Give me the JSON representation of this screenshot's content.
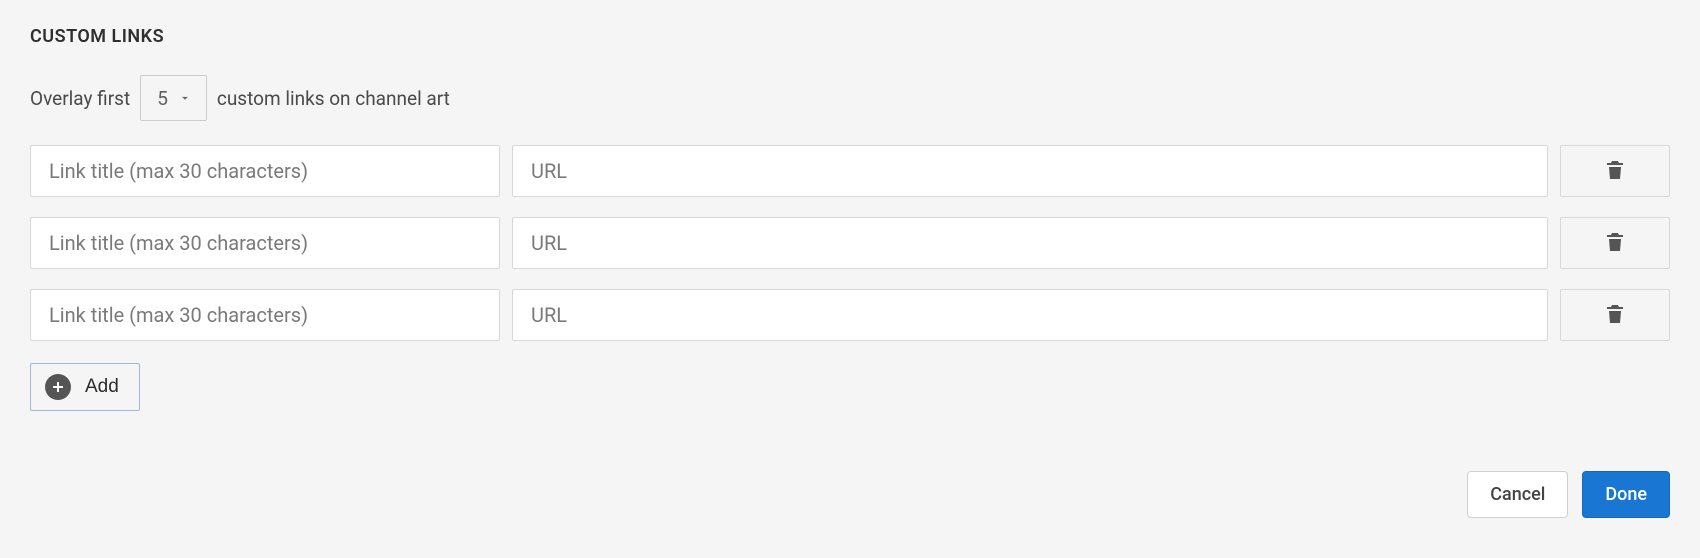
{
  "section_title": "CUSTOM LINKS",
  "overlay": {
    "prefix": "Overlay first",
    "value": "5",
    "suffix": "custom links on channel art"
  },
  "rows": [
    {
      "title_placeholder": "Link title (max 30 characters)",
      "url_placeholder": "URL"
    },
    {
      "title_placeholder": "Link title (max 30 characters)",
      "url_placeholder": "URL"
    },
    {
      "title_placeholder": "Link title (max 30 characters)",
      "url_placeholder": "URL"
    }
  ],
  "add_label": "Add",
  "footer": {
    "cancel": "Cancel",
    "done": "Done"
  }
}
